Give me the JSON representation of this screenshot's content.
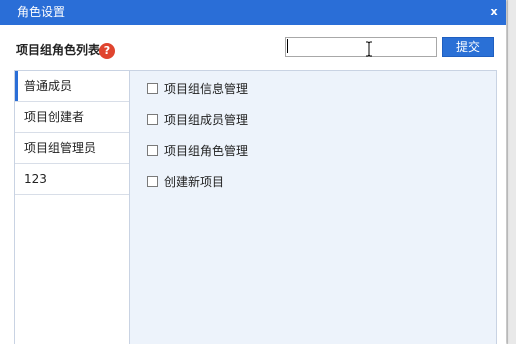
{
  "dialog": {
    "title": "角色设置",
    "close_glyph": "x"
  },
  "header": {
    "label": "项目组角色列表",
    "help_glyph": "?",
    "search_value": "",
    "submit_label": "提交"
  },
  "roles": [
    {
      "label": "普通成员",
      "active": true
    },
    {
      "label": "项目创建者",
      "active": false
    },
    {
      "label": "项目组管理员",
      "active": false
    },
    {
      "label": "123",
      "active": false
    }
  ],
  "permissions": [
    {
      "label": "项目组信息管理",
      "checked": false
    },
    {
      "label": "项目组成员管理",
      "checked": false
    },
    {
      "label": "项目组角色管理",
      "checked": false
    },
    {
      "label": "创建新项目",
      "checked": false
    }
  ],
  "colors": {
    "titlebar": "#2a6ed7",
    "accent_button": "#2a70d6",
    "help_icon": "#e0442e",
    "permission_area": "#edf3fb"
  }
}
